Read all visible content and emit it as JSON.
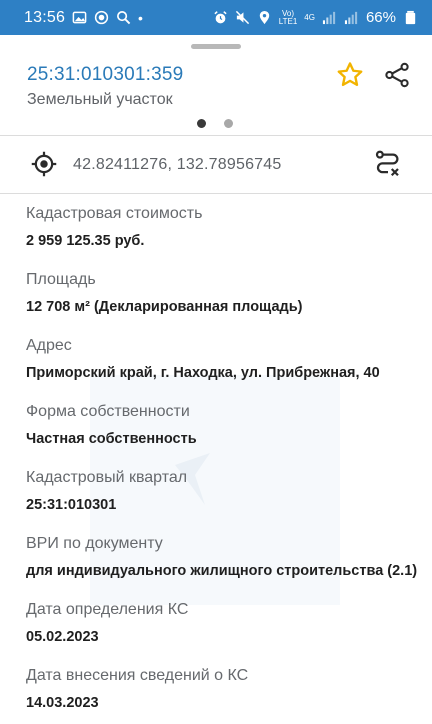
{
  "status_bar": {
    "time": "13:56",
    "battery": "66%",
    "volte_top": "Vo)",
    "volte_bottom": "LTE1",
    "network": "4G"
  },
  "header": {
    "cadastral_number": "25:31:010301:359",
    "object_type": "Земельный участок",
    "pages_total": 2,
    "page_active": 1
  },
  "coordinates": {
    "text": "42.82411276, 132.78956745"
  },
  "details": [
    {
      "label": "Кадастровая стоимость",
      "value": "2 959 125.35 руб."
    },
    {
      "label": "Площадь",
      "value": "12 708 м² (Декларированная площадь)"
    },
    {
      "label": "Адрес",
      "value": "Приморский край, г. Находка, ул. Прибрежная, 40"
    },
    {
      "label": "Форма собственности",
      "value": "Частная собственность"
    },
    {
      "label": "Кадастровый квартал",
      "value": "25:31:010301"
    },
    {
      "label": "ВРИ по документу",
      "value": "для индивидуального жилищного строительства (2.1)"
    },
    {
      "label": "Дата определения КС",
      "value": "05.02.2023"
    },
    {
      "label": "Дата внесения сведений о КС",
      "value": "14.03.2023"
    }
  ],
  "colors": {
    "status_bar": "#2e80c5",
    "cadastral_number": "#2a7ab8",
    "star": "#f2b400"
  },
  "icons": {
    "favorite": "star-icon",
    "share": "share-icon",
    "locate": "crosshair-icon",
    "route": "route-icon"
  }
}
